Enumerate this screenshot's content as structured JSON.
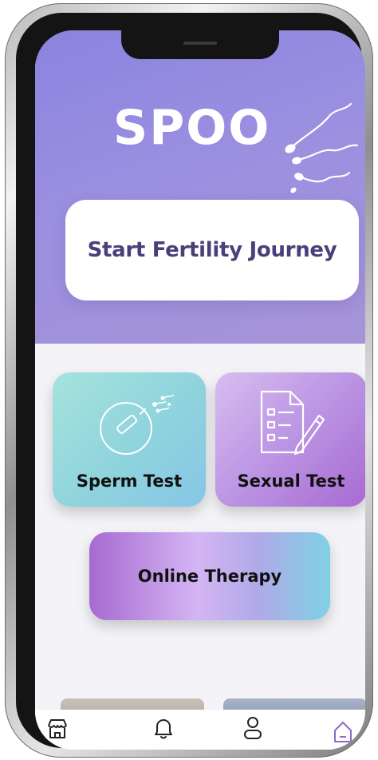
{
  "app": {
    "logo_text": "SPOO"
  },
  "hero": {
    "start_label": "Start Fertility Journey"
  },
  "tiles": {
    "sperm_label": "Sperm Test",
    "sexual_label": "Sexual Test",
    "therapy_label": "Online Therapy"
  },
  "nav": {
    "items": [
      {
        "icon": "store-icon"
      },
      {
        "icon": "bell-icon"
      },
      {
        "icon": "person-icon"
      },
      {
        "icon": "home-icon",
        "active": true
      }
    ]
  },
  "colors": {
    "hero_start": "#8a84e0",
    "hero_end": "#a694d8",
    "start_text": "#4a3f7a",
    "accent_active": "#8a6ad0"
  }
}
